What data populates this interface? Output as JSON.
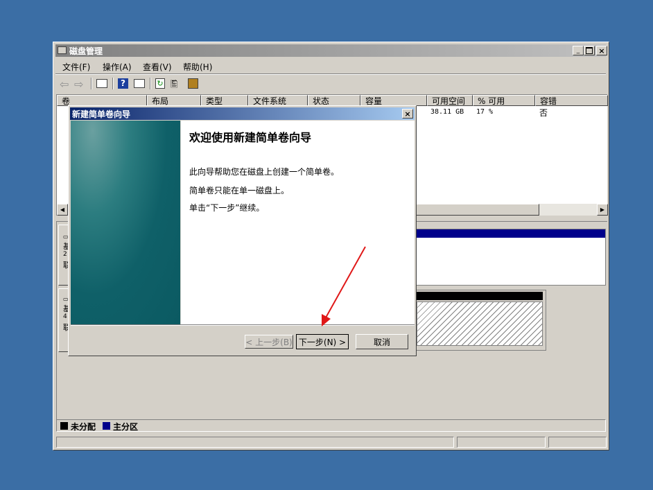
{
  "window": {
    "title": "磁盘管理"
  },
  "menu": [
    {
      "label": "文件(F)"
    },
    {
      "label": "操作(A)"
    },
    {
      "label": "查看(V)"
    },
    {
      "label": "帮助(H)"
    }
  ],
  "columns": [
    "卷",
    "布局",
    "类型",
    "文件系统",
    "状态",
    "容量",
    "可用空间",
    "% 可用",
    "容错"
  ],
  "row1": {
    "free": "38.11 GB",
    "percent": "17 %",
    "fault": "否"
  },
  "disk_labels": {
    "disk0": [
      "基",
      "2",
      "联"
    ],
    "disk1": [
      "基",
      "4",
      "联"
    ]
  },
  "legend": {
    "unallocated": "未分配",
    "primary": "主分区"
  },
  "colors": {
    "desktop": "#3b6ea5",
    "unallocated": "#000000",
    "primary": "#00008b",
    "dialog_title_start": "#0a246a",
    "dialog_title_end": "#a6caf0"
  },
  "dialog": {
    "title": "新建简单卷向导",
    "heading": "欢迎使用新建简单卷向导",
    "line1": "此向导帮助您在磁盘上创建一个简单卷。",
    "line2": "简单卷只能在单一磁盘上。",
    "line3": "单击“下一步”继续。",
    "back_label": "< 上一步(B)",
    "next_label": "下一步(N) >",
    "cancel_label": "取消"
  }
}
